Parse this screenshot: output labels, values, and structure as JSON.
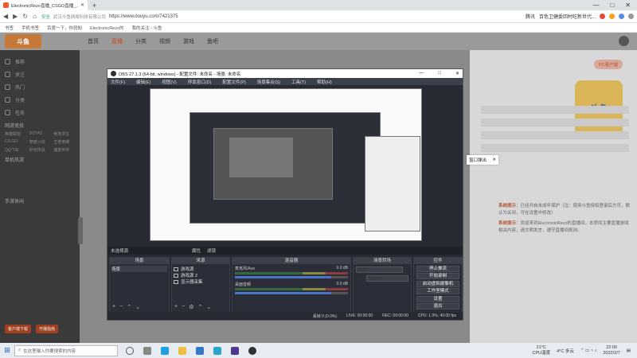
{
  "browser": {
    "tab_title": "ElectronicRezo直播_CSGO直播_...",
    "new_tab": "+",
    "win_min": "—",
    "win_max": "□",
    "win_close": "✕",
    "back": "◀",
    "forward": "▶",
    "refresh": "↻",
    "home": "⌂",
    "secure": "安全",
    "site_owner": "武汉斗鱼网络科技有限公司",
    "url": "https://www.douyu.com/7421375",
    "addr_right": [
      "腾讯",
      "百色卫健委回村吃新世代..."
    ],
    "bookmarks": [
      "书签",
      "手机书签",
      "百度一下，你就知",
      "ElectronicRezo的",
      "我的关注 - 斗鱼"
    ]
  },
  "site": {
    "logo": "斗鱼",
    "nav": [
      "首页",
      "直播",
      "分类",
      "视频",
      "游戏",
      "鱼吧"
    ],
    "active_nav": "直播",
    "sidebar": {
      "items": [
        "推荐",
        "关注",
        "热门",
        "分类",
        "任务"
      ],
      "section1": "网游竞技",
      "grid1": [
        "英雄联盟",
        "DOTA2",
        "绝地求生",
        "CS:GO",
        "穿越火线",
        "王者荣耀",
        "QQ飞车",
        "炉石传说",
        "魔兽世界"
      ],
      "section2": "单机热游",
      "section3": "手游休闲",
      "bottom": [
        "客户端下载",
        "开播指南"
      ]
    },
    "right": {
      "pc_label": "PC客户端",
      "badge": "斗鱼",
      "msg1_label": "系统提示",
      "msg1": "：已经开启未成年保护（注：使用斗鱼授权登录后方可，默认为关闭，可在设置中修改）",
      "msg2_label": "系统提示",
      "msg2": "：欢迎来到ElectronicRezo的直播间，本房间主要直播游戏相关内容，请文明发言，遵守直播间规则。"
    },
    "popout_label": "窗口弹出",
    "popout_close": "✕"
  },
  "obs": {
    "title": "OBS 27.1.3 (64-bit, windows) - 配置文件: 未命名 - 场景: 未命名",
    "ctrl_min": "—",
    "ctrl_max": "□",
    "ctrl_close": "✕",
    "menu": [
      "文件(F)",
      "编辑(E)",
      "视图(V)",
      "停靠窗口(D)",
      "配置文件(P)",
      "场景集合(S)",
      "工具(T)",
      "帮助(H)"
    ],
    "preview_bar_label": "未选择源",
    "preview_bar_props": "属性",
    "preview_bar_filters": "滤镜",
    "scenes": {
      "header": "场景",
      "items": [
        "场景"
      ]
    },
    "sources": {
      "header": "来源",
      "items": [
        "游戏源",
        "游戏源 2",
        "显示器采集"
      ]
    },
    "mixer": {
      "header": "混音器",
      "channels": [
        {
          "name": "麦克风/Aux",
          "db": "0.0 dB",
          "level": 0.85
        },
        {
          "name": "桌面音频",
          "db": "0.0 dB",
          "level": 0.85
        }
      ]
    },
    "transitions": {
      "header": "场景转场",
      "type": "淡出",
      "duration_label": "时长",
      "duration": "300 ms"
    },
    "controls": {
      "header": "控件",
      "buttons": [
        "停止推流",
        "开始录制",
        "启动虚拟摄像机",
        "工作室模式",
        "设置",
        "退出"
      ]
    },
    "status": [
      "丢帧 0 (0.0%)",
      "LIVE: 00:00:00",
      "REC: 00:00:00",
      "CPU: 1.9%, 40.00 fps"
    ]
  },
  "taskbar": {
    "search": "在这里输入你要搜索的内容",
    "weather_temp": "21°C",
    "weather_label": "CPU温度",
    "weather2": "4°C 多云",
    "time": "22:00",
    "date": "2022/2/7"
  },
  "colors": {
    "accent": "#c24a1a",
    "obs_bg": "#272a33",
    "sidebar_bg": "#3a3a3a"
  }
}
